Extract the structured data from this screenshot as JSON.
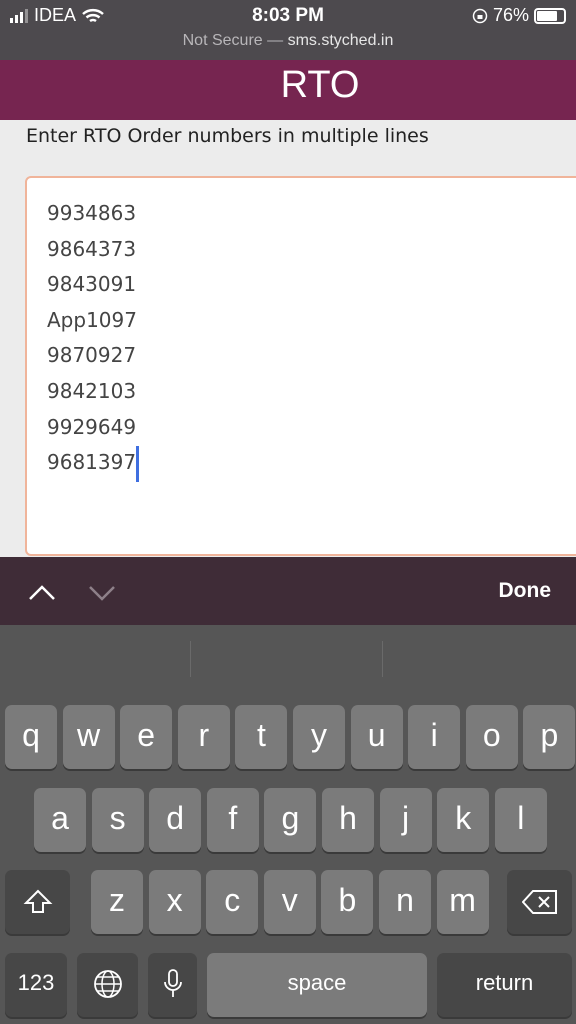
{
  "status": {
    "carrier": "IDEA",
    "time": "8:03 PM",
    "battery": "76%",
    "battery_level": 0.76
  },
  "browser": {
    "security": "Not Secure —",
    "domain": "sms.styched.in"
  },
  "header": {
    "title": "RTO"
  },
  "form": {
    "label": "Enter RTO Order numbers in multiple lines",
    "lines": [
      "9934863",
      "9864373",
      "9843091",
      "App1097",
      "9870927",
      "9842103",
      "9929649",
      "9681397"
    ]
  },
  "accessory": {
    "done": "Done"
  },
  "keyboard": {
    "row1": [
      "q",
      "w",
      "e",
      "r",
      "t",
      "y",
      "u",
      "i",
      "o",
      "p"
    ],
    "row2": [
      "a",
      "s",
      "d",
      "f",
      "g",
      "h",
      "j",
      "k",
      "l"
    ],
    "row3": [
      "z",
      "x",
      "c",
      "v",
      "b",
      "n",
      "m"
    ],
    "numbers": "123",
    "space": "space",
    "return": "return"
  }
}
